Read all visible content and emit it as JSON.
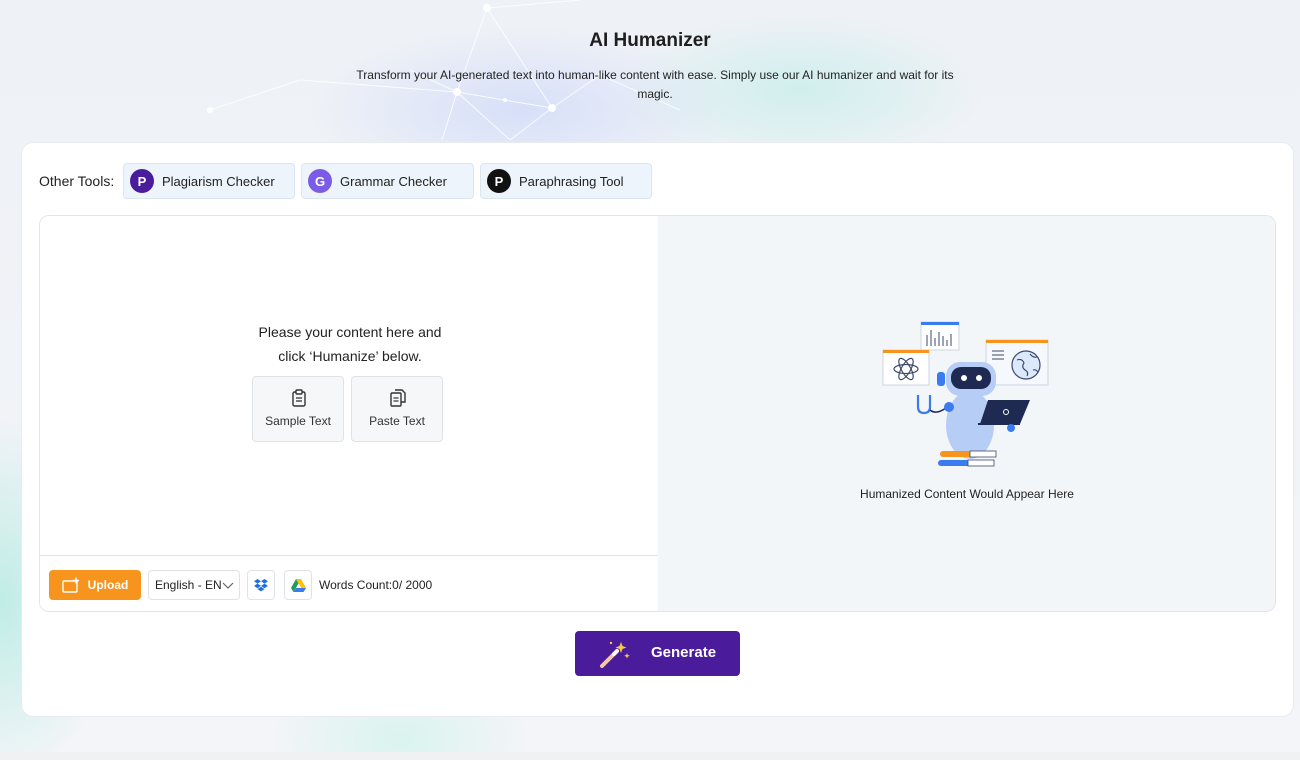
{
  "hero": {
    "title": "AI Humanizer",
    "subtitle": "Transform your AI-generated text into human-like content with ease. Simply use our AI humanizer and wait for its magic."
  },
  "tools": {
    "label": "Other Tools:",
    "items": [
      {
        "letter": "P",
        "label": "Plagiarism Checker",
        "color": "#4a1c9c"
      },
      {
        "letter": "G",
        "label": "Grammar Checker",
        "color": "#7b5ce6"
      },
      {
        "letter": "P",
        "label": "Paraphrasing Tool",
        "color": "#111111"
      }
    ]
  },
  "input": {
    "prompt_line1": "Please your content here and",
    "prompt_line2": "click ‘Humanize’ below.",
    "sample_label": "Sample Text",
    "paste_label": "Paste Text"
  },
  "footer": {
    "upload_label": "Upload",
    "language": "English - EN",
    "dropbox_icon": "dropbox-icon",
    "drive_icon": "google-drive-icon",
    "words_label": "Words Count:",
    "words_value": "0",
    "words_max": "/ 2000"
  },
  "output": {
    "placeholder": "Humanized Content Would Appear Here"
  },
  "generate": {
    "label": "Generate"
  },
  "colors": {
    "accent": "#4a1c9c",
    "upload": "#f7941d",
    "output_bg": "#f3f6f8"
  }
}
